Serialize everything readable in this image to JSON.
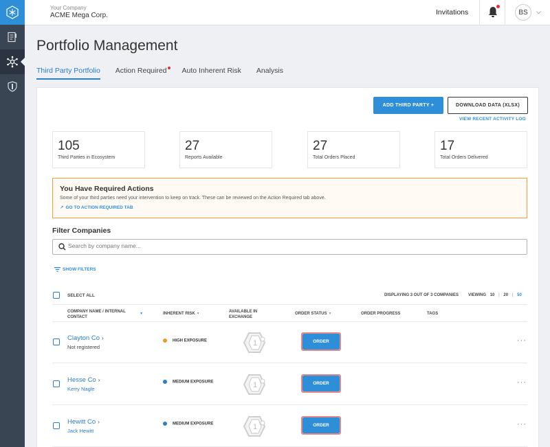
{
  "topbar": {
    "company_label": "Your Company",
    "company_name": "ACME Mega Corp.",
    "invitations_label": "Invitations",
    "avatar_initials": "BS"
  },
  "page": {
    "title": "Portfolio Management"
  },
  "tabs": [
    {
      "label": "Third Party Portfolio",
      "active": true
    },
    {
      "label": "Action Required",
      "notification": true
    },
    {
      "label": "Auto Inherent Risk"
    },
    {
      "label": "Analysis"
    }
  ],
  "actions": {
    "add_label": "ADD THIRD PARTY +",
    "download_label": "DOWNLOAD DATA (XLSX)",
    "activity_link": "VIEW RECENT ACTIVITY LOG"
  },
  "stats": [
    {
      "value": "105",
      "label": "Third Parties in Ecosystem"
    },
    {
      "value": "27",
      "label": "Reports Available"
    },
    {
      "value": "27",
      "label": "Total Orders Placed"
    },
    {
      "value": "17",
      "label": "Total Orders Delivered"
    }
  ],
  "alert": {
    "title": "You Have Required Actions",
    "text": "Some of your third parties need your intervention to keep on track. These can be reviewed on the Action Required tab above.",
    "link": "GO TO ACTION REQUIRED TAB"
  },
  "filter": {
    "title": "Filter Companies",
    "search_placeholder": "Search by company name...",
    "show_filters": "SHOW FILTERS"
  },
  "table": {
    "select_all": "SELECT ALL",
    "displaying": "DISPLAYING 3 OUT OF 3 COMPANIES",
    "viewing_label": "VIEWING",
    "page_sizes": [
      "10",
      "20",
      "50"
    ],
    "headers": {
      "company_line1": "COMPANY NAME / INTERNAL",
      "company_line2": "CONTACT",
      "risk": "INHERENT RISK",
      "exchange_line1": "AVAILABLE IN",
      "exchange_line2": "EXCHANGE",
      "status": "ORDER STATUS",
      "progress": "ORDER PROGRESS",
      "tags": "TAGS"
    },
    "rows": [
      {
        "name": "Clayton Co",
        "contact": "Not registered",
        "risk": "HIGH EXPOSURE",
        "risk_color": "#f0932b",
        "exchange_count": "1",
        "order_label": "ORDER"
      },
      {
        "name": "Hesse Co",
        "contact": "Kerry Nagle",
        "risk": "MEDIUM EXPOSURE",
        "risk_color": "#2e7ec6",
        "exchange_count": "1",
        "order_label": "ORDER"
      },
      {
        "name": "Hewitt Co",
        "contact": "Jack Hewitt",
        "risk": "MEDIUM EXPOSURE",
        "risk_color": "#2e7ec6",
        "exchange_count": "1",
        "order_label": "ORDER"
      }
    ]
  },
  "colors": {
    "accent": "#2e8ed8",
    "rail": "#3a4553",
    "alert_border": "#f0a040"
  }
}
